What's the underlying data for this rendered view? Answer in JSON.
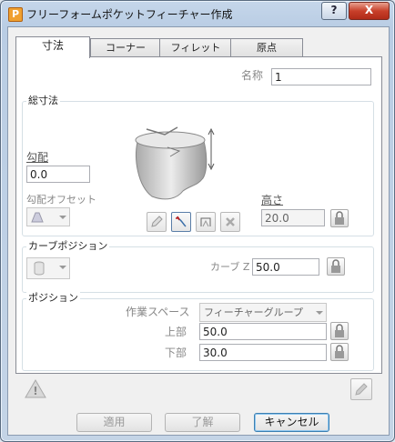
{
  "window": {
    "title": "フリーフォームポケットフィーチャー作成",
    "help_label": "?",
    "close_label": "X"
  },
  "tabs": [
    {
      "label": "寸法",
      "active": true
    },
    {
      "label": "コーナー",
      "active": false
    },
    {
      "label": "フィレット",
      "active": false
    },
    {
      "label": "原点",
      "active": false
    }
  ],
  "name_field": {
    "label": "名称",
    "value": "1"
  },
  "overall_dimensions": {
    "title": "総寸法",
    "draft_label": "勾配",
    "draft_value": "0.0",
    "draft_offset_label": "勾配オフセット",
    "height_label": "高さ",
    "height_value": "20.0"
  },
  "curve_position": {
    "title": "カーブポジション",
    "curve_z_label": "カーブ Z",
    "curve_z_value": "50.0"
  },
  "position": {
    "title": "ポジション",
    "workspace_label": "作業スペース",
    "workspace_value": "フィーチャーグループ",
    "top_label": "上部",
    "top_value": "50.0",
    "bottom_label": "下部",
    "bottom_value": "30.0"
  },
  "footer": {
    "apply_label": "適用",
    "ok_label": "了解",
    "cancel_label": "キャンセル"
  },
  "icons": [
    "app-icon",
    "pocket-preview-icon",
    "draft-offset-icon",
    "pencil-icon",
    "select-curve-icon",
    "profile-icon",
    "delete-icon",
    "lock-icon",
    "cylinder-icon",
    "warning-icon",
    "edit-icon"
  ]
}
